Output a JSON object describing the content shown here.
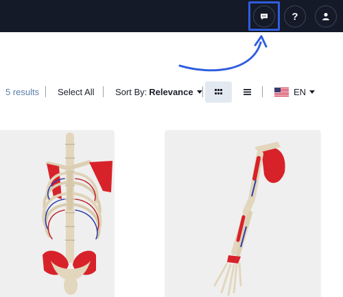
{
  "header": {
    "icons": {
      "chat": "chat-bubble-icon",
      "help": "question-mark-icon",
      "account": "user-icon"
    },
    "help_label": "?"
  },
  "toolbar": {
    "results_label": "5 results",
    "select_all_label": "Select All",
    "sort_prefix": "Sort By:",
    "sort_value": "Relevance",
    "language": "EN"
  },
  "results": [
    {
      "image": "skeleton-torso-model"
    },
    {
      "image": "skeleton-arm-model"
    }
  ],
  "colors": {
    "topbar": "#141a28",
    "highlight": "#2f5ee0",
    "results_text": "#5b7ea8",
    "active_view": "#e3e9f1"
  }
}
